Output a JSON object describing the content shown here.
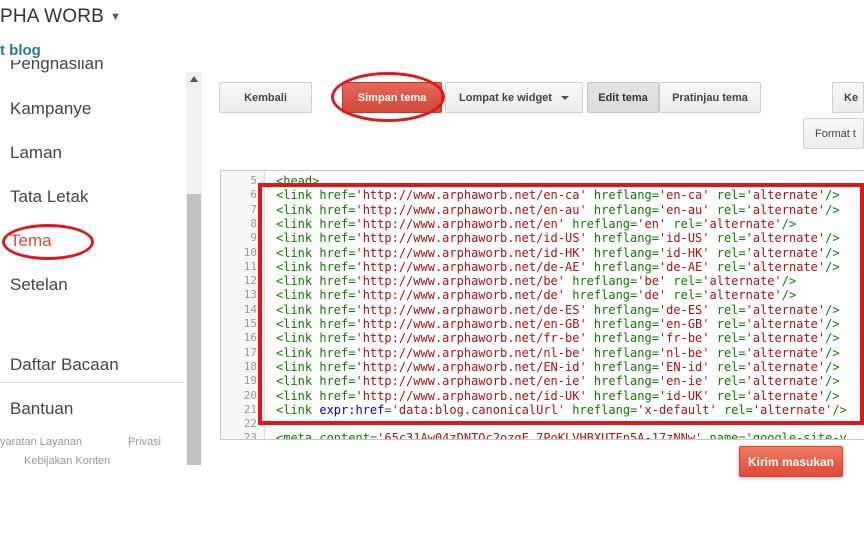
{
  "header": {
    "blog_title": "PHA WORB",
    "view_blog": "t blog"
  },
  "sidebar": {
    "items": [
      {
        "label": "Penghasilan"
      },
      {
        "label": "Kampanye"
      },
      {
        "label": "Laman"
      },
      {
        "label": "Tata Letak"
      },
      {
        "label": "Tema"
      },
      {
        "label": "Setelan"
      },
      {
        "label": "Daftar Bacaan"
      },
      {
        "label": "Bantuan"
      }
    ],
    "active_index": 4,
    "footer": {
      "terms": "yaratan Layanan",
      "privacy": "Privasi",
      "content_policy": "Kebijakan Konten"
    }
  },
  "toolbar": {
    "back_label": "Kembali",
    "save_label": "Simpan tema",
    "jump_label": "Lompat ke widget",
    "edit_label": "Edit tema",
    "preview_label": "Pratinjau tema",
    "right_partial_label": "Ke",
    "format_label": "Format t"
  },
  "editor": {
    "lines": [
      {
        "num": "5",
        "text": "<head>"
      },
      {
        "num": "6",
        "text": "<link href='http://www.arphaworb.net/en-ca' hreflang='en-ca' rel='alternate'/>"
      },
      {
        "num": "7",
        "text": "<link href='http://www.arphaworb.net/en-au' hreflang='en-au' rel='alternate'/>"
      },
      {
        "num": "8",
        "text": "<link href='http://www.arphaworb.net/en' hreflang='en' rel='alternate'/>"
      },
      {
        "num": "9",
        "text": "<link href='http://www.arphaworb.net/id-US' hreflang='id-US' rel='alternate'/>"
      },
      {
        "num": "10",
        "text": "<link href='http://www.arphaworb.net/id-HK' hreflang='id-HK' rel='alternate'/>"
      },
      {
        "num": "11",
        "text": "<link href='http://www.arphaworb.net/de-AE' hreflang='de-AE' rel='alternate'/>"
      },
      {
        "num": "12",
        "text": "<link href='http://www.arphaworb.net/be' hreflang='be' rel='alternate'/>"
      },
      {
        "num": "13",
        "text": "<link href='http://www.arphaworb.net/de' hreflang='de' rel='alternate'/>"
      },
      {
        "num": "14",
        "text": "<link href='http://www.arphaworb.net/de-ES' hreflang='de-ES' rel='alternate'/>"
      },
      {
        "num": "15",
        "text": "<link href='http://www.arphaworb.net/en-GB' hreflang='en-GB' rel='alternate'/>"
      },
      {
        "num": "16",
        "text": "<link href='http://www.arphaworb.net/fr-be' hreflang='fr-be' rel='alternate'/>"
      },
      {
        "num": "17",
        "text": "<link href='http://www.arphaworb.net/nl-be' hreflang='nl-be' rel='alternate'/>"
      },
      {
        "num": "18",
        "text": "<link href='http://www.arphaworb.net/EN-id' hreflang='EN-id' rel='alternate'/>"
      },
      {
        "num": "19",
        "text": "<link href='http://www.arphaworb.net/en-ie' hreflang='en-ie' rel='alternate'/>"
      },
      {
        "num": "20",
        "text": "<link href='http://www.arphaworb.net/id-UK' hreflang='id-UK' rel='alternate'/>"
      },
      {
        "num": "21",
        "text": "<link expr:href='data:blog.canonicalUrl' hreflang='x-default' rel='alternate'/>"
      },
      {
        "num": "22",
        "text": ""
      },
      {
        "num": "23",
        "text": "<meta content='65c31Aw04zDNTOc2ozgE_7PoKLVHBXUTEp5A-17zNNw' name='google-site-v"
      }
    ]
  },
  "feedback": {
    "label": "Kirim masukan"
  },
  "colors": {
    "accent": "#dd4b39",
    "primary_button": "#d14836",
    "annotation": "#e0161d",
    "code_tag": "#117700",
    "code_string": "#aa1111",
    "code_attr": "#0000cc"
  }
}
